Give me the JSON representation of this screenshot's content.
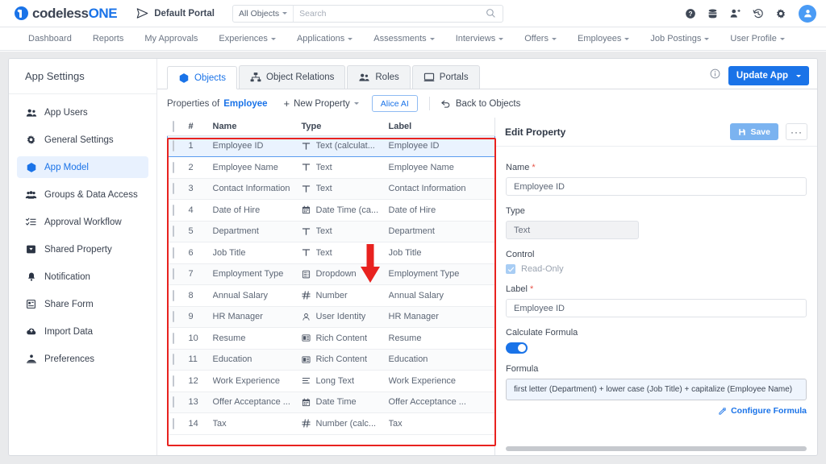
{
  "header": {
    "logo_text_dark": "codeless",
    "logo_text_blue": "ONE",
    "portal_label": "Default Portal",
    "search_scope": "All Objects",
    "search_placeholder": "Search",
    "search_value": "",
    "icons": [
      "help-icon",
      "database-icon",
      "add-user-icon",
      "history-icon",
      "gear-icon",
      "avatar"
    ]
  },
  "nav": {
    "items": [
      {
        "label": "Dashboard",
        "caret": false
      },
      {
        "label": "Reports",
        "caret": false
      },
      {
        "label": "My Approvals",
        "caret": false
      },
      {
        "label": "Experiences",
        "caret": true
      },
      {
        "label": "Applications",
        "caret": true
      },
      {
        "label": "Assessments",
        "caret": true
      },
      {
        "label": "Interviews",
        "caret": true
      },
      {
        "label": "Offers",
        "caret": true
      },
      {
        "label": "Employees",
        "caret": true
      },
      {
        "label": "Job Postings",
        "caret": true
      },
      {
        "label": "User Profile",
        "caret": true
      }
    ]
  },
  "sidebar": {
    "title": "App Settings",
    "items": [
      {
        "label": "App Users",
        "icon": "users-icon",
        "active": false
      },
      {
        "label": "General Settings",
        "icon": "gear-icon",
        "active": false
      },
      {
        "label": "App Model",
        "icon": "cube-icon",
        "active": true
      },
      {
        "label": "Groups & Data Access",
        "icon": "group-icon",
        "active": false
      },
      {
        "label": "Approval Workflow",
        "icon": "list-check-icon",
        "active": false
      },
      {
        "label": "Shared Property",
        "icon": "tag-icon",
        "active": false
      },
      {
        "label": "Notification",
        "icon": "bell-icon",
        "active": false
      },
      {
        "label": "Share Form",
        "icon": "form-icon",
        "active": false
      },
      {
        "label": "Import Data",
        "icon": "cloud-upload-icon",
        "active": false
      },
      {
        "label": "Preferences",
        "icon": "preferences-icon",
        "active": false
      }
    ]
  },
  "tabs": [
    {
      "label": "Objects",
      "icon": "cube-icon",
      "active": true
    },
    {
      "label": "Object Relations",
      "icon": "relations-icon",
      "active": false
    },
    {
      "label": "Roles",
      "icon": "roles-icon",
      "active": false
    },
    {
      "label": "Portals",
      "icon": "portal-icon",
      "active": false
    }
  ],
  "toolbar": {
    "info_icon": "info-icon",
    "update_app_label": "Update App"
  },
  "properties_bar": {
    "prefix": "Properties of",
    "object_name": "Employee",
    "new_property_label": "New Property",
    "alice_ai_label": "Alice AI",
    "back_label": "Back to Objects"
  },
  "table": {
    "columns": [
      "#",
      "Name",
      "Type",
      "Label"
    ],
    "rows": [
      {
        "num": "1",
        "name": "Employee ID",
        "type": "Text (calculat...",
        "type_icon": "text-icon",
        "label": "Employee ID",
        "flag": true,
        "selected": true
      },
      {
        "num": "2",
        "name": "Employee Name",
        "type": "Text",
        "type_icon": "text-icon",
        "label": "Employee Name",
        "flag": false,
        "selected": false
      },
      {
        "num": "3",
        "name": "Contact Information",
        "type": "Text",
        "type_icon": "text-icon",
        "label": "Contact Information",
        "flag": false,
        "selected": false
      },
      {
        "num": "4",
        "name": "Date of Hire",
        "type": "Date Time (ca...",
        "type_icon": "date-icon",
        "label": "Date of Hire",
        "flag": true,
        "selected": false
      },
      {
        "num": "5",
        "name": "Department",
        "type": "Text",
        "type_icon": "text-icon",
        "label": "Department",
        "flag": false,
        "selected": false
      },
      {
        "num": "6",
        "name": "Job Title",
        "type": "Text",
        "type_icon": "text-icon",
        "label": "Job Title",
        "flag": false,
        "selected": false
      },
      {
        "num": "7",
        "name": "Employment Type",
        "type": "Dropdown",
        "type_icon": "dropdown-icon",
        "label": "Employment Type",
        "flag": false,
        "selected": false
      },
      {
        "num": "8",
        "name": "Annual Salary",
        "type": "Number",
        "type_icon": "number-icon",
        "label": "Annual Salary",
        "flag": false,
        "selected": false
      },
      {
        "num": "9",
        "name": "HR Manager",
        "type": "User Identity",
        "type_icon": "user-icon",
        "label": "HR Manager",
        "flag": false,
        "selected": false
      },
      {
        "num": "10",
        "name": "Resume",
        "type": "Rich Content",
        "type_icon": "rich-icon",
        "label": "Resume",
        "flag": false,
        "selected": false
      },
      {
        "num": "11",
        "name": "Education",
        "type": "Rich Content",
        "type_icon": "rich-icon",
        "label": "Education",
        "flag": false,
        "selected": false
      },
      {
        "num": "12",
        "name": "Work Experience",
        "type": "Long Text",
        "type_icon": "longtext-icon",
        "label": "Work Experience",
        "flag": false,
        "selected": false
      },
      {
        "num": "13",
        "name": "Offer Acceptance ...",
        "type": "Date Time",
        "type_icon": "date-icon",
        "label": "Offer Acceptance ...",
        "flag": false,
        "selected": false
      },
      {
        "num": "14",
        "name": "Tax",
        "type": "Number (calc...",
        "type_icon": "number-icon",
        "label": "Tax",
        "flag": true,
        "selected": false
      }
    ]
  },
  "edit_property": {
    "title": "Edit Property",
    "save_label": "Save",
    "more_label": "···",
    "name_label": "Name",
    "name_value": "Employee ID",
    "type_label": "Type",
    "type_value": "Text",
    "control_label": "Control",
    "readonly_label": "Read-Only",
    "readonly_checked": true,
    "label_label": "Label",
    "label_value": "Employee ID",
    "calculate_formula_label": "Calculate Formula",
    "calculate_formula_on": true,
    "formula_label": "Formula",
    "formula_value": "first letter (Department) + lower case (Job Title) + capitalize (Employee Name)",
    "configure_formula_label": "Configure Formula"
  },
  "annotation": {
    "highlight_color": "#e8221f",
    "arrow_target_row": "1"
  },
  "colors": {
    "accent": "#1a73e8",
    "flag": "#f5c518",
    "annotation_red": "#e8221f"
  }
}
